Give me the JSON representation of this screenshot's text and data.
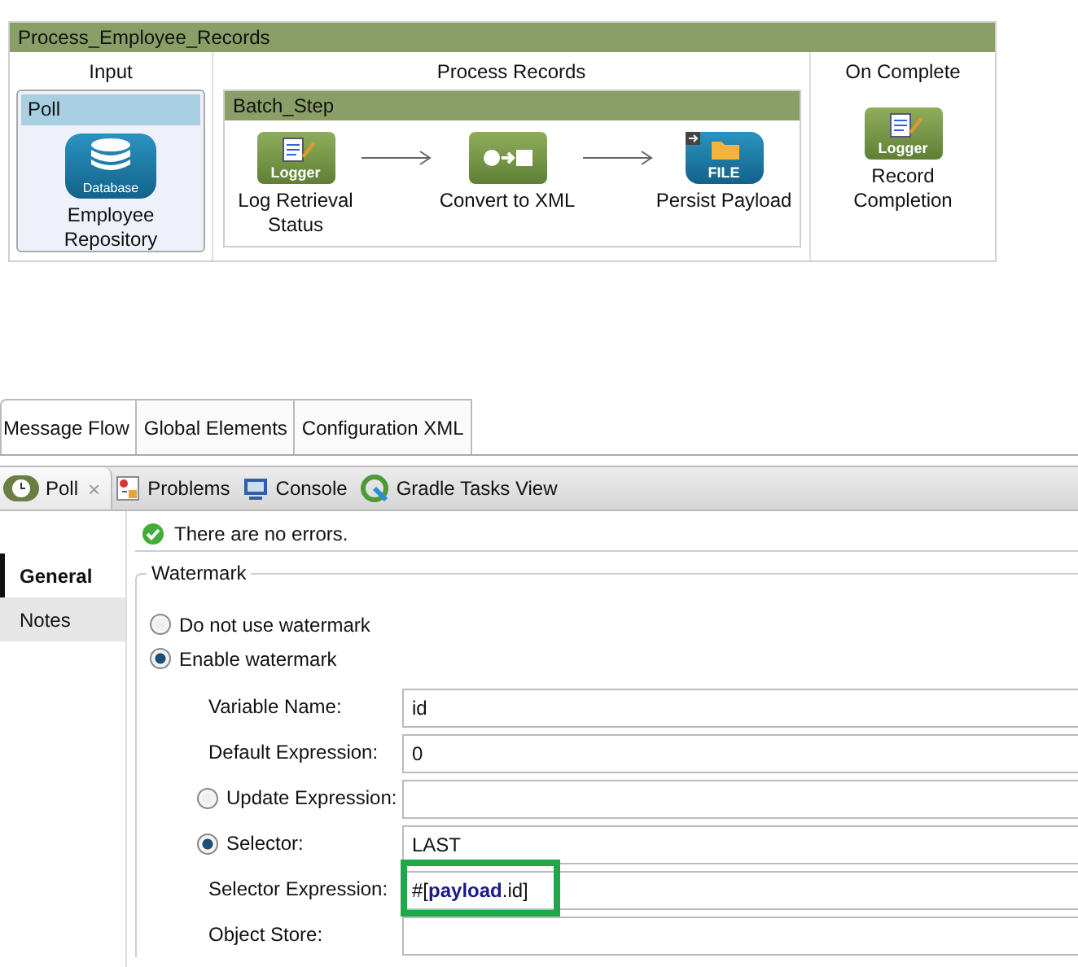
{
  "flow": {
    "title": "Process_Employee_Records",
    "input": {
      "heading": "Input",
      "source": {
        "title": "Poll",
        "kind": "database",
        "icon_label": "Database",
        "name": "Employee Repository"
      }
    },
    "process": {
      "heading": "Process Records",
      "step": {
        "title": "Batch_Step",
        "nodes": [
          {
            "kind": "logger",
            "icon_label": "Logger",
            "name": "Log Retrieval Status"
          },
          {
            "kind": "transform",
            "name": "Convert to XML"
          },
          {
            "kind": "file",
            "icon_label": "FILE",
            "name": "Persist Payload"
          }
        ]
      }
    },
    "on_complete": {
      "heading": "On Complete",
      "nodes": [
        {
          "kind": "logger",
          "icon_label": "Logger",
          "name": "Record Completion"
        }
      ]
    }
  },
  "editor_tabs": [
    {
      "label": "Message Flow",
      "selected": true
    },
    {
      "label": "Global Elements",
      "selected": false
    },
    {
      "label": "Configuration XML",
      "selected": false
    }
  ],
  "view_tabs": [
    {
      "kind": "poll",
      "label": "Poll",
      "selected": true,
      "close": "×"
    },
    {
      "kind": "problems",
      "label": "Problems",
      "selected": false
    },
    {
      "kind": "console",
      "label": "Console",
      "selected": false
    },
    {
      "kind": "gradle",
      "label": "Gradle Tasks View",
      "selected": false
    }
  ],
  "side_tabs": [
    {
      "label": "General",
      "selected": true
    },
    {
      "label": "Notes",
      "selected": false
    }
  ],
  "status": "There are no errors.",
  "watermark": {
    "title": "Watermark",
    "options": [
      {
        "label": "Do not use watermark",
        "selected": false
      },
      {
        "label": "Enable watermark",
        "selected": true
      }
    ],
    "fields": [
      {
        "kind": "text",
        "label": "Variable Name:",
        "value": "id"
      },
      {
        "kind": "text",
        "label": "Default Expression:",
        "value": "0"
      },
      {
        "kind": "radio",
        "label": "Update Expression:",
        "selected": false
      },
      {
        "kind": "radio",
        "label": "Selector:",
        "selected": true,
        "value": "LAST"
      },
      {
        "kind": "text",
        "label": "Selector Expression:",
        "value": "#[**payload**.id]",
        "highlighted": true
      },
      {
        "kind": "text",
        "label": "Object Store:"
      }
    ]
  }
}
